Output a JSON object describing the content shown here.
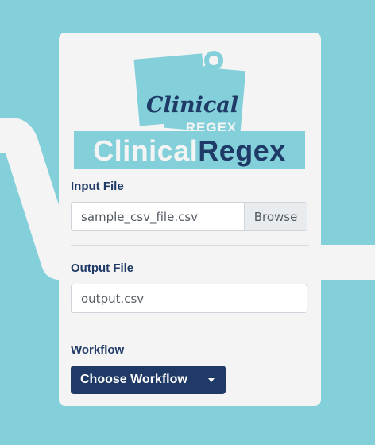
{
  "colors": {
    "background": "#83d0da",
    "card": "#f4f4f4",
    "navy": "#1f3a66",
    "wave": "#f4f4f4"
  },
  "logo": {
    "name": "clinical-regex-logo",
    "line1": "Clinical",
    "line2": "REGEX"
  },
  "wordmark": {
    "part1": "Clinical",
    "part2": "Regex"
  },
  "input_file": {
    "label": "Input File",
    "value": "sample_csv_file.csv",
    "browse_label": "Browse"
  },
  "output_file": {
    "label": "Output File",
    "value": "output.csv"
  },
  "workflow": {
    "label": "Workflow",
    "button_label": "Choose Workflow",
    "icon": "caret-down-icon"
  }
}
